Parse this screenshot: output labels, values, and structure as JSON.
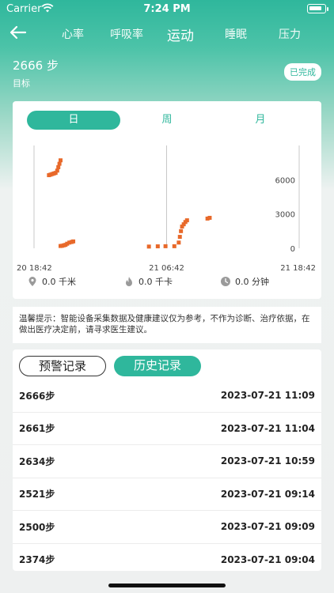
{
  "status_bar": {
    "carrier": "Carrier",
    "time": "7:24 PM"
  },
  "nav": {
    "tabs": [
      {
        "label": "心率",
        "active": false
      },
      {
        "label": "呼吸率",
        "active": false
      },
      {
        "label": "运动",
        "active": true
      },
      {
        "label": "睡眠",
        "active": false
      },
      {
        "label": "压力",
        "active": false
      }
    ]
  },
  "summary": {
    "steps": "2666 步",
    "target_label": "目标",
    "badge": "已完成"
  },
  "period_tabs": [
    {
      "label": "日",
      "active": true
    },
    {
      "label": "周",
      "active": false
    },
    {
      "label": "月",
      "active": false
    }
  ],
  "chart_data": {
    "type": "scatter",
    "color": "#e8692a",
    "x_tick_labels": [
      "20 18:42",
      "21 06:42",
      "21 18:42"
    ],
    "y_tick_labels": [
      "6000",
      "3000",
      "0"
    ],
    "ylim": [
      0,
      9000
    ],
    "xlim": [
      0,
      24
    ],
    "series": [
      {
        "points": [
          [
            1.35,
            6400
          ],
          [
            1.5,
            6450
          ],
          [
            1.65,
            6500
          ],
          [
            1.8,
            6550
          ],
          [
            1.95,
            6600
          ],
          [
            2.1,
            6800
          ],
          [
            2.2,
            7100
          ],
          [
            2.3,
            7400
          ],
          [
            2.4,
            7700
          ],
          [
            2.4,
            200
          ],
          [
            2.55,
            220
          ],
          [
            2.7,
            260
          ],
          [
            2.85,
            300
          ],
          [
            3.0,
            400
          ],
          [
            3.2,
            500
          ],
          [
            3.4,
            550
          ],
          [
            3.55,
            600
          ],
          [
            10.4,
            150
          ],
          [
            11.2,
            170
          ],
          [
            11.9,
            180
          ],
          [
            12.7,
            180
          ],
          [
            13.1,
            500
          ],
          [
            13.2,
            1000
          ],
          [
            13.3,
            1500
          ],
          [
            13.4,
            1900
          ],
          [
            13.55,
            2100
          ],
          [
            13.7,
            2300
          ],
          [
            13.85,
            2450
          ],
          [
            15.7,
            2600
          ],
          [
            15.9,
            2666
          ]
        ]
      }
    ]
  },
  "metrics": {
    "distance": "0.0 千米",
    "calories": "0.0 千卡",
    "duration": "0.0 分钟"
  },
  "tip": "温馨提示：智能设备采集数据及健康建议仅为参考，不作为诊断、治疗依据，在做出医疗决定前，请寻求医生建议。",
  "record_tabs": {
    "warning": "预警记录",
    "history": "历史记录"
  },
  "records": [
    {
      "steps": "2666步",
      "time": "2023-07-21 11:09"
    },
    {
      "steps": "2661步",
      "time": "2023-07-21 11:04"
    },
    {
      "steps": "2634步",
      "time": "2023-07-21 10:59"
    },
    {
      "steps": "2521步",
      "time": "2023-07-21 09:14"
    },
    {
      "steps": "2500步",
      "time": "2023-07-21 09:09"
    },
    {
      "steps": "2374步",
      "time": "2023-07-21 09:04"
    }
  ]
}
